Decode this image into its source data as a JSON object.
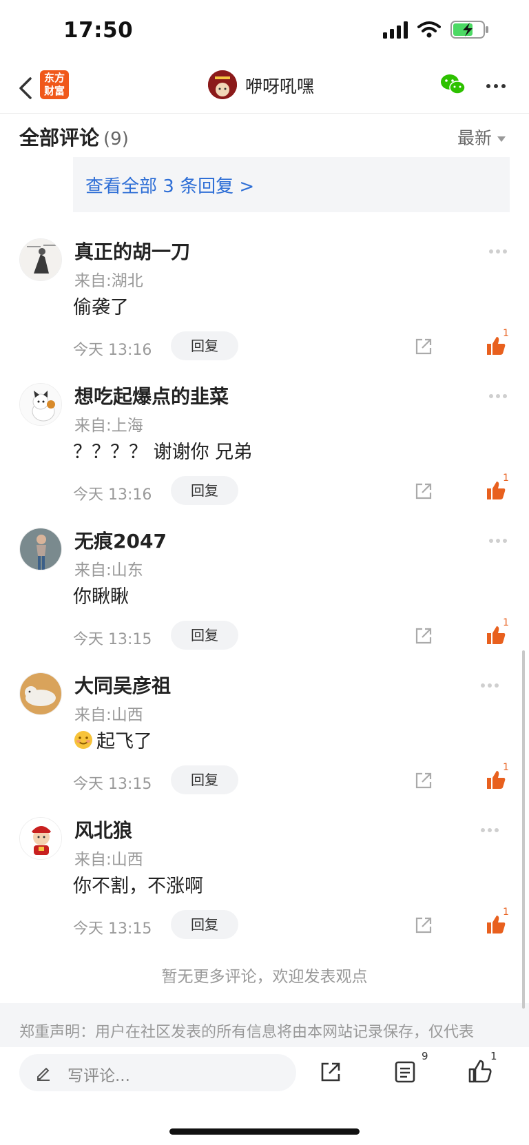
{
  "status": {
    "time": "17:50"
  },
  "nav": {
    "logo_line1": "东方",
    "logo_line2": "财富",
    "title": "咿呀吼嘿"
  },
  "section": {
    "title": "全部评论",
    "count": "(9)",
    "sort": "最新"
  },
  "reply_preview": {
    "more": "查看全部 3 条回复 >"
  },
  "comments": [
    {
      "name": "真正的胡一刀",
      "location": "来自:湖北",
      "text": "偷袭了",
      "time": "今天 13:16",
      "reply": "回复",
      "likes": "1"
    },
    {
      "name": "想吃起爆点的韭菜",
      "location": "来自:上海",
      "text": "？？？？ 谢谢你 兄弟",
      "time": "今天 13:16",
      "reply": "回复",
      "likes": "1"
    },
    {
      "name": "无痕2047",
      "location": "来自:山东",
      "text": "你瞅瞅",
      "time": "今天 13:15",
      "reply": "回复",
      "likes": "1"
    },
    {
      "name": "大同吴彦祖",
      "location": "来自:山西",
      "text": "起飞了",
      "time": "今天 13:15",
      "reply": "回复",
      "likes": "1"
    },
    {
      "name": "风北狼",
      "location": "来自:山西",
      "text": "你不割，不涨啊",
      "time": "今天 13:15",
      "reply": "回复",
      "likes": "1"
    }
  ],
  "footer": {
    "no_more": "暂无更多评论，欢迎发表观点",
    "disclaimer": "郑重声明：用户在社区发表的所有信息将由本网站记录保存，仅代表"
  },
  "bottom": {
    "placeholder": "写评论...",
    "list_count": "9",
    "like_count": "1"
  },
  "colors": {
    "accent_orange": "#e8601e",
    "link_blue": "#2f6fd6",
    "logo_red": "#f0581a"
  }
}
